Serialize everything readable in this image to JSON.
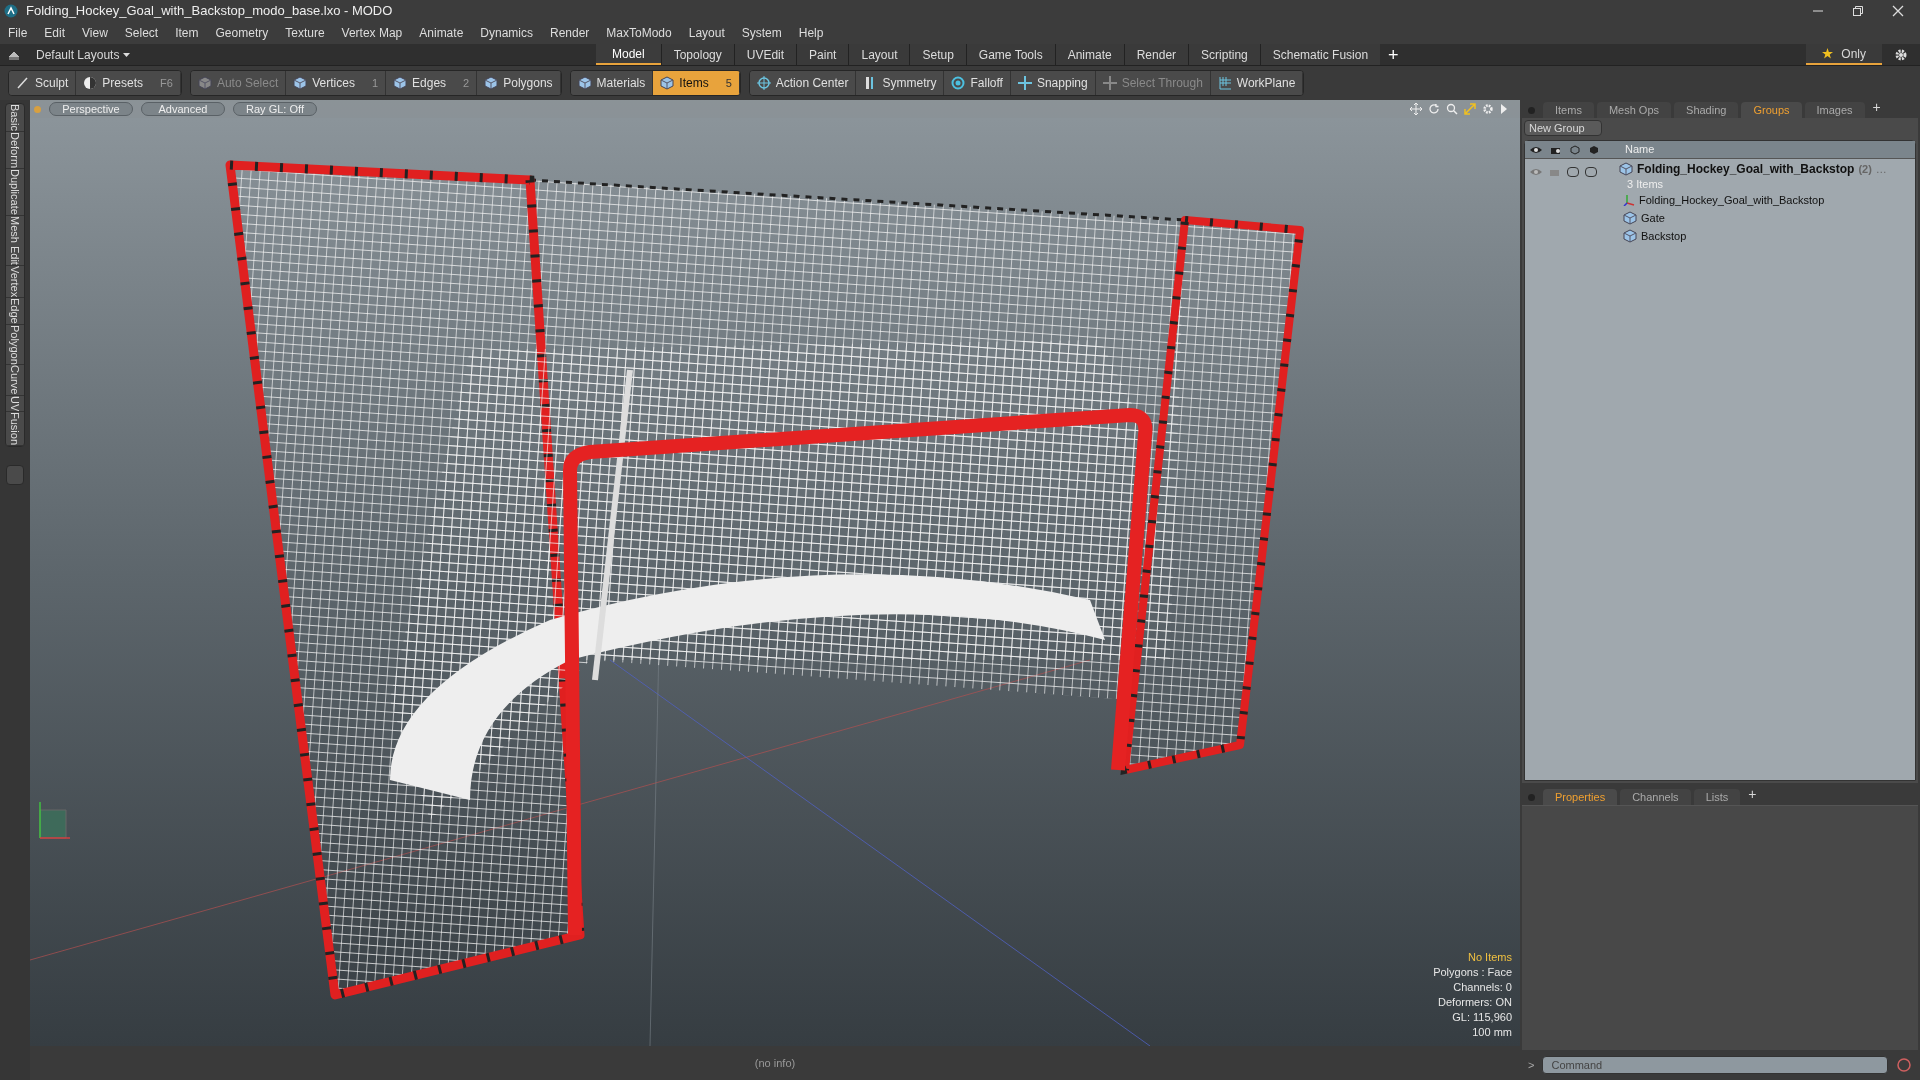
{
  "window": {
    "title": "Folding_Hockey_Goal_with_Backstop_modo_base.lxo - MODO"
  },
  "menu": [
    "File",
    "Edit",
    "View",
    "Select",
    "Item",
    "Geometry",
    "Texture",
    "Vertex Map",
    "Animate",
    "Dynamics",
    "Render",
    "MaxToModo",
    "Layout",
    "System",
    "Help"
  ],
  "layouts": {
    "label": "Default Layouts",
    "tabs": [
      {
        "label": "Model",
        "selected": true
      },
      {
        "label": "Topology",
        "selected": false
      },
      {
        "label": "UVEdit",
        "selected": false
      },
      {
        "label": "Paint",
        "selected": false
      },
      {
        "label": "Layout",
        "selected": false
      },
      {
        "label": "Setup",
        "selected": false
      },
      {
        "label": "Game Tools",
        "selected": false
      },
      {
        "label": "Animate",
        "selected": false
      },
      {
        "label": "Render",
        "selected": false
      },
      {
        "label": "Scripting",
        "selected": false
      },
      {
        "label": "Schematic Fusion",
        "selected": false
      }
    ],
    "add": "+",
    "only": "Only"
  },
  "toolbar": [
    {
      "items": [
        {
          "label": "Sculpt",
          "kind": "brush",
          "selected": false,
          "disabled": false
        },
        {
          "label": "Presets",
          "shortcut": "F6",
          "kind": "ball",
          "selected": false,
          "disabled": false
        }
      ]
    },
    {
      "items": [
        {
          "label": "Auto Select",
          "kind": "cube",
          "selected": false,
          "disabled": true
        },
        {
          "label": "Vertices",
          "shortcut": "1",
          "kind": "cube",
          "selected": false,
          "disabled": false
        },
        {
          "label": "Edges",
          "shortcut": "2",
          "kind": "cube",
          "selected": false,
          "disabled": false
        },
        {
          "label": "Polygons",
          "kind": "cube",
          "selected": false,
          "disabled": false
        }
      ]
    },
    {
      "items": [
        {
          "label": "Materials",
          "kind": "cube",
          "selected": false,
          "disabled": false
        },
        {
          "label": "Items",
          "shortcut": "5",
          "kind": "cube",
          "selected": true,
          "disabled": false
        }
      ]
    },
    {
      "items": [
        {
          "label": "Action Center",
          "kind": "target",
          "selected": false,
          "disabled": false
        },
        {
          "label": "Symmetry",
          "kind": "bar",
          "selected": false,
          "disabled": false
        },
        {
          "label": "Falloff",
          "kind": "ring",
          "selected": false,
          "disabled": false
        },
        {
          "label": "Snapping",
          "kind": "cross",
          "selected": false,
          "disabled": false
        },
        {
          "label": "Select Through",
          "kind": "cross",
          "selected": false,
          "disabled": true
        },
        {
          "label": "WorkPlane",
          "kind": "grid",
          "selected": false,
          "disabled": false
        }
      ]
    }
  ],
  "side_tabs": [
    "Basic",
    "Deform",
    "Duplicate",
    "Mesh Edit",
    "Vertex",
    "Edge",
    "Polygon",
    "Curve",
    "UV",
    "Fusion"
  ],
  "viewport": {
    "buttons": [
      "Perspective",
      "Advanced",
      "Ray GL: Off"
    ],
    "stats": [
      {
        "text": "No Items",
        "kind": "highlight"
      },
      {
        "text": "Polygons : Face",
        "kind": "plain"
      },
      {
        "text": "Channels: 0",
        "kind": "plain"
      },
      {
        "text": "Deformers: ON",
        "kind": "plain"
      },
      {
        "text": "GL: 115,960",
        "kind": "plain"
      },
      {
        "text": "100 mm",
        "kind": "plain"
      }
    ]
  },
  "status_bar": {
    "text": "(no info)"
  },
  "right_panel": {
    "tabs": [
      {
        "label": "Items",
        "selected": false
      },
      {
        "label": "Mesh Ops",
        "selected": false
      },
      {
        "label": "Shading",
        "selected": false
      },
      {
        "label": "Groups",
        "selected": true
      },
      {
        "label": "Images",
        "selected": false
      }
    ],
    "add": "+",
    "new_group": "New Group",
    "column": "Name",
    "group": {
      "name": "Folding_Hockey_Goal_with_Backstop",
      "count": "(2)",
      "overflow": "…",
      "subtitle": "3 Items",
      "children": [
        {
          "name": "Folding_Hockey_Goal_with_Backstop",
          "kind": "locator"
        },
        {
          "name": "Gate",
          "kind": "mesh"
        },
        {
          "name": "Backstop",
          "kind": "mesh"
        }
      ]
    }
  },
  "properties": {
    "tabs": [
      {
        "label": "Properties",
        "selected": true
      },
      {
        "label": "Channels",
        "selected": false
      },
      {
        "label": "Lists",
        "selected": false
      }
    ],
    "add": "+"
  },
  "command": {
    "prompt": ">",
    "placeholder": "Command"
  }
}
